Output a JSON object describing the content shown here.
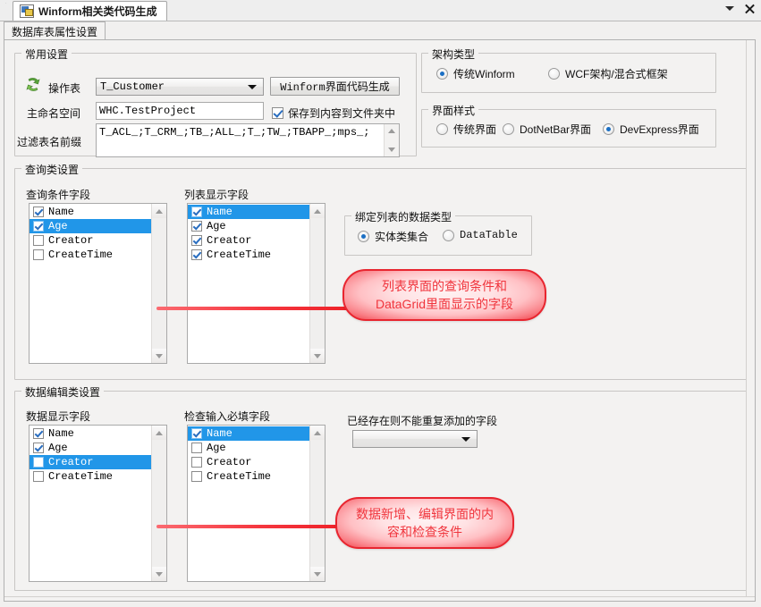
{
  "window": {
    "tab_title": "Winform相关类代码生成",
    "icon": "winform-icon",
    "caret_icon": "chevron-down-icon",
    "close_icon": "close-icon"
  },
  "page_tab": {
    "label": "数据库表属性设置"
  },
  "common_settings": {
    "title": "常用设置",
    "refresh_icon": "recycle-icon",
    "table_label": "操作表",
    "table_value": "T_Customer",
    "generate_button": "Winform界面代码生成",
    "namespace_label": "主命名空间",
    "namespace_value": "WHC.TestProject",
    "save_checkbox_label": "保存到内容到文件夹中",
    "save_checkbox_checked": true,
    "filter_label": "过滤表名前缀",
    "filter_value": "T_ACL_;T_CRM_;TB_;ALL_;T_;TW_;TBAPP_;mps_;"
  },
  "arch_type": {
    "title": "架构类型",
    "options": [
      {
        "label": "传统Winform",
        "selected": true
      },
      {
        "label": "WCF架构/混合式框架",
        "selected": false
      }
    ]
  },
  "ui_style": {
    "title": "界面样式",
    "options": [
      {
        "label": "传统界面",
        "selected": false
      },
      {
        "label": "DotNetBar界面",
        "selected": false
      },
      {
        "label": "DevExpress界面",
        "selected": true
      }
    ]
  },
  "query_settings": {
    "title": "查询类设置",
    "condition_list": {
      "label": "查询条件字段",
      "items": [
        {
          "text": "Name",
          "checked": true,
          "selected": false
        },
        {
          "text": "Age",
          "checked": true,
          "selected": true
        },
        {
          "text": "Creator",
          "checked": false,
          "selected": false
        },
        {
          "text": "CreateTime",
          "checked": false,
          "selected": false
        }
      ]
    },
    "display_list": {
      "label": "列表显示字段",
      "items": [
        {
          "text": "Name",
          "checked": true,
          "selected": true
        },
        {
          "text": "Age",
          "checked": true,
          "selected": false
        },
        {
          "text": "Creator",
          "checked": true,
          "selected": false
        },
        {
          "text": "CreateTime",
          "checked": true,
          "selected": false
        }
      ]
    },
    "bind_type": {
      "title": "绑定列表的数据类型",
      "options": [
        {
          "label": "实体类集合",
          "selected": true
        },
        {
          "label": "DataTable",
          "selected": false
        }
      ]
    },
    "callout": {
      "line1": "列表界面的查询条件和",
      "line2": "DataGrid里面显示的字段"
    }
  },
  "edit_settings": {
    "title": "数据编辑类设置",
    "display_list": {
      "label": "数据显示字段",
      "items": [
        {
          "text": "Name",
          "checked": true,
          "selected": false
        },
        {
          "text": "Age",
          "checked": true,
          "selected": false
        },
        {
          "text": "Creator",
          "checked": false,
          "selected": true
        },
        {
          "text": "CreateTime",
          "checked": false,
          "selected": false
        }
      ]
    },
    "required_list": {
      "label": "检查输入必填字段",
      "items": [
        {
          "text": "Name",
          "checked": true,
          "selected": true
        },
        {
          "text": "Age",
          "checked": false,
          "selected": false
        },
        {
          "text": "Creator",
          "checked": false,
          "selected": false
        },
        {
          "text": "CreateTime",
          "checked": false,
          "selected": false
        }
      ]
    },
    "unique_field": {
      "label": "已经存在则不能重复添加的字段",
      "value": ""
    },
    "callout": {
      "line1": "数据新增、编辑界面的内",
      "line2": "容和检查条件"
    }
  },
  "colors": {
    "selection_blue": "#2196e8",
    "callout_red": "#e8252f",
    "callout_text": "#f0353d",
    "panel_bg": "#f3f2f1"
  }
}
